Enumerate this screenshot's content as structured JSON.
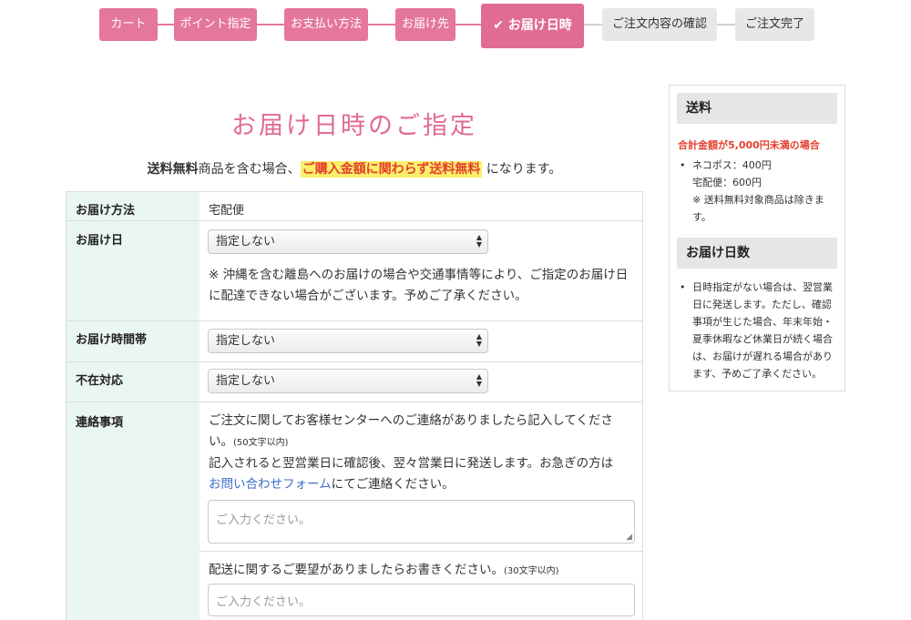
{
  "steps": [
    {
      "label": "カート",
      "state": "done"
    },
    {
      "label": "ポイント指定",
      "state": "done"
    },
    {
      "label": "お支払い方法",
      "state": "done"
    },
    {
      "label": "お届け先",
      "state": "done"
    },
    {
      "label": "お届け日時",
      "state": "current"
    },
    {
      "label": "ご注文内容の確認",
      "state": "todo"
    },
    {
      "label": "ご注文完了",
      "state": "todo"
    }
  ],
  "page": {
    "title": "お届け日時のご指定",
    "notice_bold": "送料無料",
    "notice_mid": "商品を含む場合、",
    "notice_highlight": "ご購入金額に関わらず送料無料",
    "notice_end": " になります。"
  },
  "form": {
    "method": {
      "label": "お届け方法",
      "value": "宅配便"
    },
    "date": {
      "label": "お届け日",
      "select_value": "指定しない",
      "note": "※ 沖縄を含む離島へのお届けの場合や交通事情等により、ご指定のお届け日に配達できない場合がございます。予めご了承ください。"
    },
    "time": {
      "label": "お届け時間帯",
      "select_value": "指定しない"
    },
    "absence": {
      "label": "不在対応",
      "select_value": "指定しない"
    },
    "contact": {
      "label": "連絡事項",
      "text1": "ご注文に関してお客様センターへのご連絡がありましたら記入してください。",
      "limit1": "(50文字以内)",
      "text2": "記入されると翌営業日に確認後、翌々営業日に発送します。お急ぎの方は",
      "link": "お問い合わせフォーム",
      "text3": "にてご連絡ください。",
      "placeholder1": "ご入力ください。",
      "text4": "配送に関するご要望がありましたらお書きください。",
      "limit2": "(30文字以内)",
      "placeholder2": "ご入力ください。"
    }
  },
  "sidebar": {
    "shipping": {
      "title": "送料",
      "warning": "合計金額が5,000円未満の場合",
      "item_line1": "ネコポス：400円",
      "item_line2": "宅配便：600円",
      "item_line3": "※ 送料無料対象商品は除きます。"
    },
    "days": {
      "title": "お届け日数",
      "item": "日時指定がない場合は、翌営業日に発送します。ただし、確認事項が生じた場合、年末年始・夏季休暇など休業日が続く場合は、お届けが遅れる場合があります、予めご了承ください。"
    }
  },
  "colors": {
    "accent": "#e06b94",
    "label_bg": "#eaf7f0",
    "warning": "#e4402f",
    "highlight": "#fbf06a"
  }
}
